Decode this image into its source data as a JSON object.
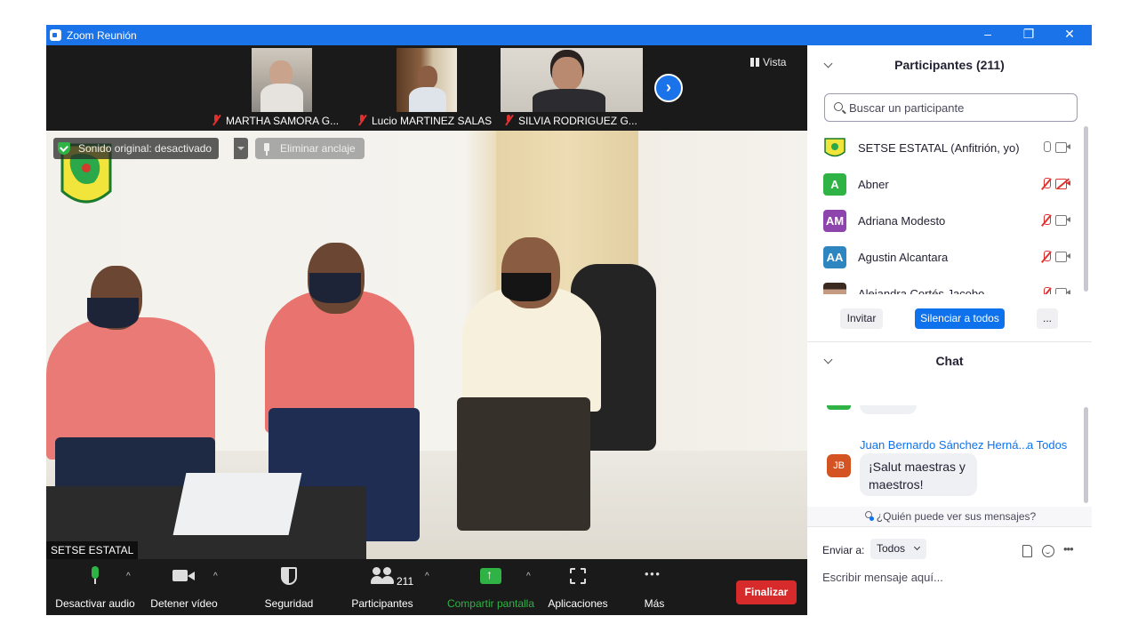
{
  "window": {
    "title": "Zoom Reunión",
    "controls": {
      "minimize": "–",
      "restore": "❐",
      "close": "✕"
    }
  },
  "gallery_strip": {
    "thumbnails": [
      {
        "name": "MARTHA SAMORA G...",
        "muted": true
      },
      {
        "name": "Lucio MARTINEZ SALAS",
        "muted": true
      },
      {
        "name": "SILVIA RODRIGUEZ G...",
        "muted": true
      }
    ],
    "view_label": "Vista"
  },
  "main_video": {
    "original_sound_label": "Sonido original: desactivado",
    "unpin_label": "Eliminar anclaje",
    "speaker_name": "SETSE ESTATAL"
  },
  "toolbar": {
    "mute_label": "Desactivar audio",
    "video_label": "Detener vídeo",
    "security_label": "Seguridad",
    "participants_label": "Participantes",
    "participants_count": "211",
    "share_label": "Compartir pantalla",
    "apps_label": "Aplicaciones",
    "more_label": "Más",
    "end_label": "Finalizar",
    "share_color": "#2fb344",
    "end_color": "#d72b2b"
  },
  "participants_panel": {
    "title": "Participantes (211)",
    "search_placeholder": "Buscar un participante",
    "participants": [
      {
        "name": "SETSE ESTATAL (Anfitrión, yo)",
        "avatar": "logo",
        "avatar_color": "#f4e24a",
        "mic_muted": false,
        "camera_off": false
      },
      {
        "name": "Abner",
        "avatar": "A",
        "avatar_color": "#2fb344",
        "mic_muted": true,
        "camera_off": true
      },
      {
        "name": "Adriana Modesto",
        "avatar": "AM",
        "avatar_color": "#8e44ad",
        "mic_muted": true,
        "camera_off": false
      },
      {
        "name": "Agustin Alcantara",
        "avatar": "AA",
        "avatar_color": "#2e86c1",
        "mic_muted": true,
        "camera_off": false
      },
      {
        "name": "Alejandra Cortés Jacobo",
        "avatar": "photo",
        "avatar_color": "#7a5a48",
        "mic_muted": true,
        "camera_off": false
      }
    ],
    "invite_label": "Invitar",
    "mute_all_label": "Silenciar a todos",
    "more_label": "..."
  },
  "chat_panel": {
    "title": "Chat",
    "message": {
      "sender": "Juan Bernardo Sánchez Herná...",
      "to_label": "a Todos",
      "initials": "JB",
      "text_line1": "¡Salut maestras y",
      "text_line2": "maestros!"
    },
    "who_can_see": "¿Quién puede ver sus mensajes?",
    "send_to_label": "Enviar a:",
    "recipient": "Todos",
    "compose_placeholder": "Escribir mensaje aquí..."
  }
}
